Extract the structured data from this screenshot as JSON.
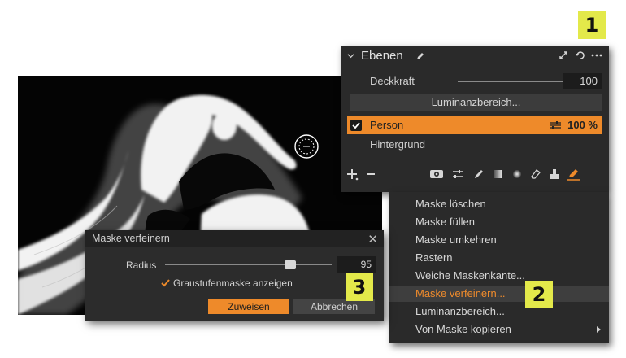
{
  "callouts": {
    "one": "1",
    "two": "2",
    "three": "3"
  },
  "layers_panel": {
    "title": "Ebenen",
    "opacity_label": "Deckkraft",
    "opacity_value": "100",
    "luminance_button": "Luminanzbereich...",
    "layers": [
      {
        "name": "Person",
        "opacity": "100 %",
        "selected": true,
        "checked": true
      },
      {
        "name": "Hintergrund",
        "selected": false
      }
    ]
  },
  "context_menu": {
    "items": [
      {
        "label": "Maske löschen"
      },
      {
        "label": "Maske füllen"
      },
      {
        "label": "Maske umkehren"
      },
      {
        "label": "Rastern"
      },
      {
        "label": "Weiche Maskenkante..."
      },
      {
        "label": "Maske verfeinern...",
        "active": true
      },
      {
        "label": "Luminanzbereich..."
      },
      {
        "label": "Von Maske kopieren",
        "submenu": true
      }
    ]
  },
  "refine_dialog": {
    "title": "Maske verfeinern",
    "close_glyph": "✕",
    "radius_label": "Radius",
    "radius_value": "95",
    "grayscale_label": "Graustufenmaske anzeigen",
    "grayscale_checked": true,
    "assign_button": "Zuweisen",
    "cancel_button": "Abbrechen"
  },
  "colors": {
    "accent": "#ee8a2a",
    "callout": "#e3e94a",
    "panel": "#2a2a2a"
  },
  "icons": [
    "chevron-down-icon",
    "pen-icon",
    "expand-icon",
    "reset-icon",
    "more-icon",
    "check-icon",
    "sliders-icon",
    "add-icon",
    "remove-icon",
    "eye-icon",
    "adjust-icon",
    "brush-icon",
    "gradient-icon",
    "radial-icon",
    "eraser-icon",
    "stamp-icon",
    "mask-brush-icon",
    "chevron-right-icon",
    "brush-cursor-icon"
  ]
}
